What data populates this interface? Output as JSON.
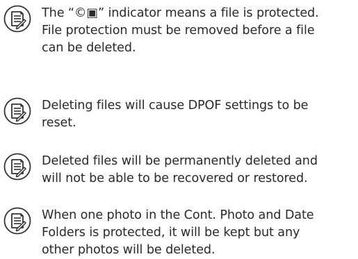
{
  "notes": [
    {
      "icon": "memo-note-icon",
      "text": "The “©▣” indicator means a file is protected.\nFile protection must be removed before a file\ncan be deleted."
    },
    {
      "icon": "memo-note-icon",
      "text": "Deleting files will cause DPOF settings to be\nreset."
    },
    {
      "icon": "memo-note-icon",
      "text": "Deleted files will be permanently deleted and\nwill not be able to be recovered or restored."
    },
    {
      "icon": "memo-note-icon",
      "text": "When one photo in the Cont. Photo and Date\nFolders is protected, it will be kept but any\nother photos will be deleted."
    }
  ],
  "colors": {
    "text": "#2a2a2a",
    "icon_stroke": "#333333",
    "background": "#ffffff"
  }
}
